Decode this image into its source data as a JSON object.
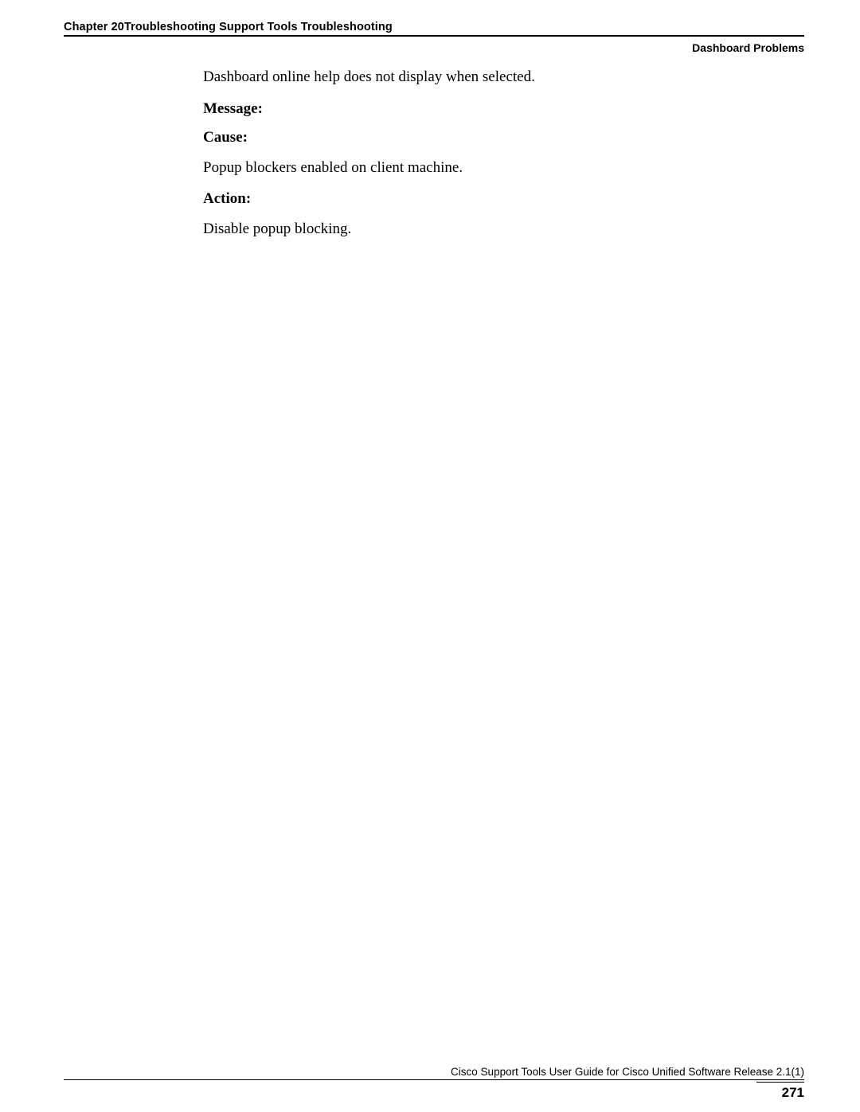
{
  "header": {
    "chapter_line": "Chapter 20Troubleshooting Support Tools Troubleshooting",
    "section_label": "Dashboard Problems"
  },
  "content": {
    "intro": "Dashboard online help does not display when selected.",
    "message_heading": "Message:",
    "cause_heading": "Cause:",
    "cause_text": "Popup blockers enabled on client machine.",
    "action_heading": "Action:",
    "action_text": "Disable popup blocking."
  },
  "footer": {
    "guide": "Cisco Support Tools User Guide for Cisco Unified Software Release 2.1(1)",
    "page_number": "271"
  }
}
